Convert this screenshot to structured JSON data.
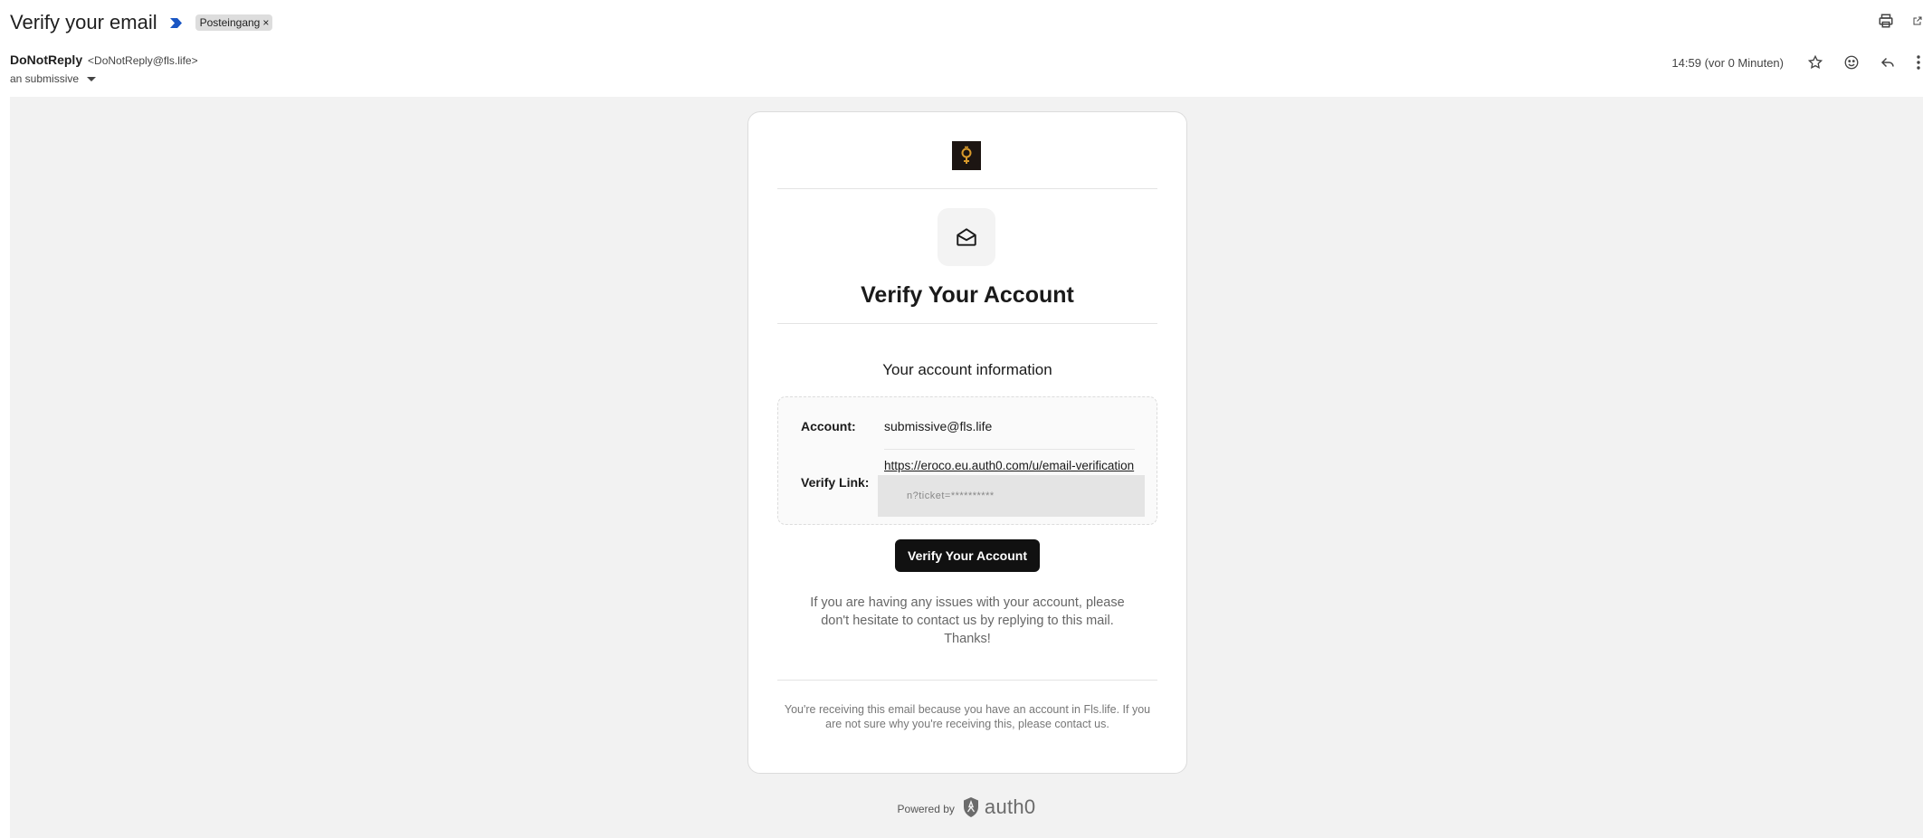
{
  "header": {
    "subject": "Verify your email",
    "label": "Posteingang",
    "label_remove": "×"
  },
  "sender": {
    "name": "DoNotReply",
    "email": "<DoNotReply@fls.life>",
    "recipient": "an submissive"
  },
  "meta": {
    "timestamp": "14:59 (vor 0 Minuten)"
  },
  "icons": [
    "print-icon",
    "open-in-new-window-icon",
    "star-icon",
    "emoji-icon",
    "reply-icon",
    "more-options-icon",
    "important-marker-icon",
    "envelope-icon",
    "auth0-shield-icon"
  ],
  "card": {
    "title": "Verify Your Account",
    "info_heading": "Your account information",
    "account_label": "Account:",
    "account_value": "submissive@fls.life",
    "link_label": "Verify Link:",
    "link_value": "https://eroco.eu.auth0.com/u/email-verification",
    "link_rest": "n?ticket=**********",
    "button_label": "Verify Your Account",
    "help_text": "If you are having any issues with your account, please don't hesitate to contact us by replying to this mail. Thanks!",
    "footer_text": "You're receiving this email because you have an account in Fls.life. If you are not sure why you're receiving this, please contact us."
  },
  "powered": {
    "label": "Powered by",
    "brand": "auth0"
  },
  "colors": {
    "page_bg": "#f2f2f2",
    "card_bg": "#ffffff",
    "button_bg": "#111111",
    "important_marker": "#1a56c4"
  }
}
